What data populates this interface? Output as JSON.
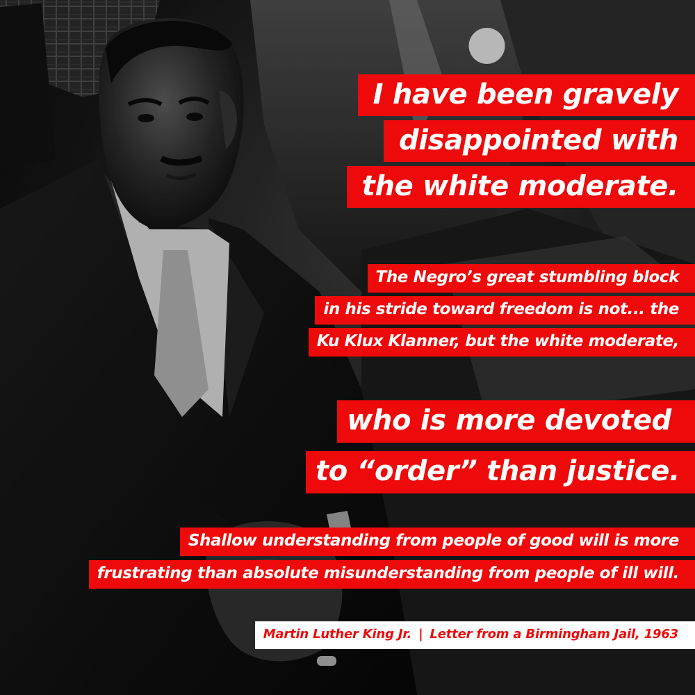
{
  "headline": [
    "I have been gravely",
    "disappointed with",
    "the white moderate."
  ],
  "body": [
    "The Negro’s great stumbling block",
    "in his stride toward freedom is not... the",
    "Ku Klux Klanner, but the white moderate,"
  ],
  "headline2": [
    "who is more devoted",
    "to “order” than justice."
  ],
  "closing": [
    "Shallow understanding from people of good will is more",
    "frustrating than absolute misunderstanding from people of ill will."
  ],
  "attribution": {
    "author": "Martin Luther King Jr.",
    "separator": "|",
    "source": "Letter from a Birmingham Jail, 1963"
  },
  "colors": {
    "bar_red": "#ee0a0a",
    "text_white": "#ffffff"
  }
}
